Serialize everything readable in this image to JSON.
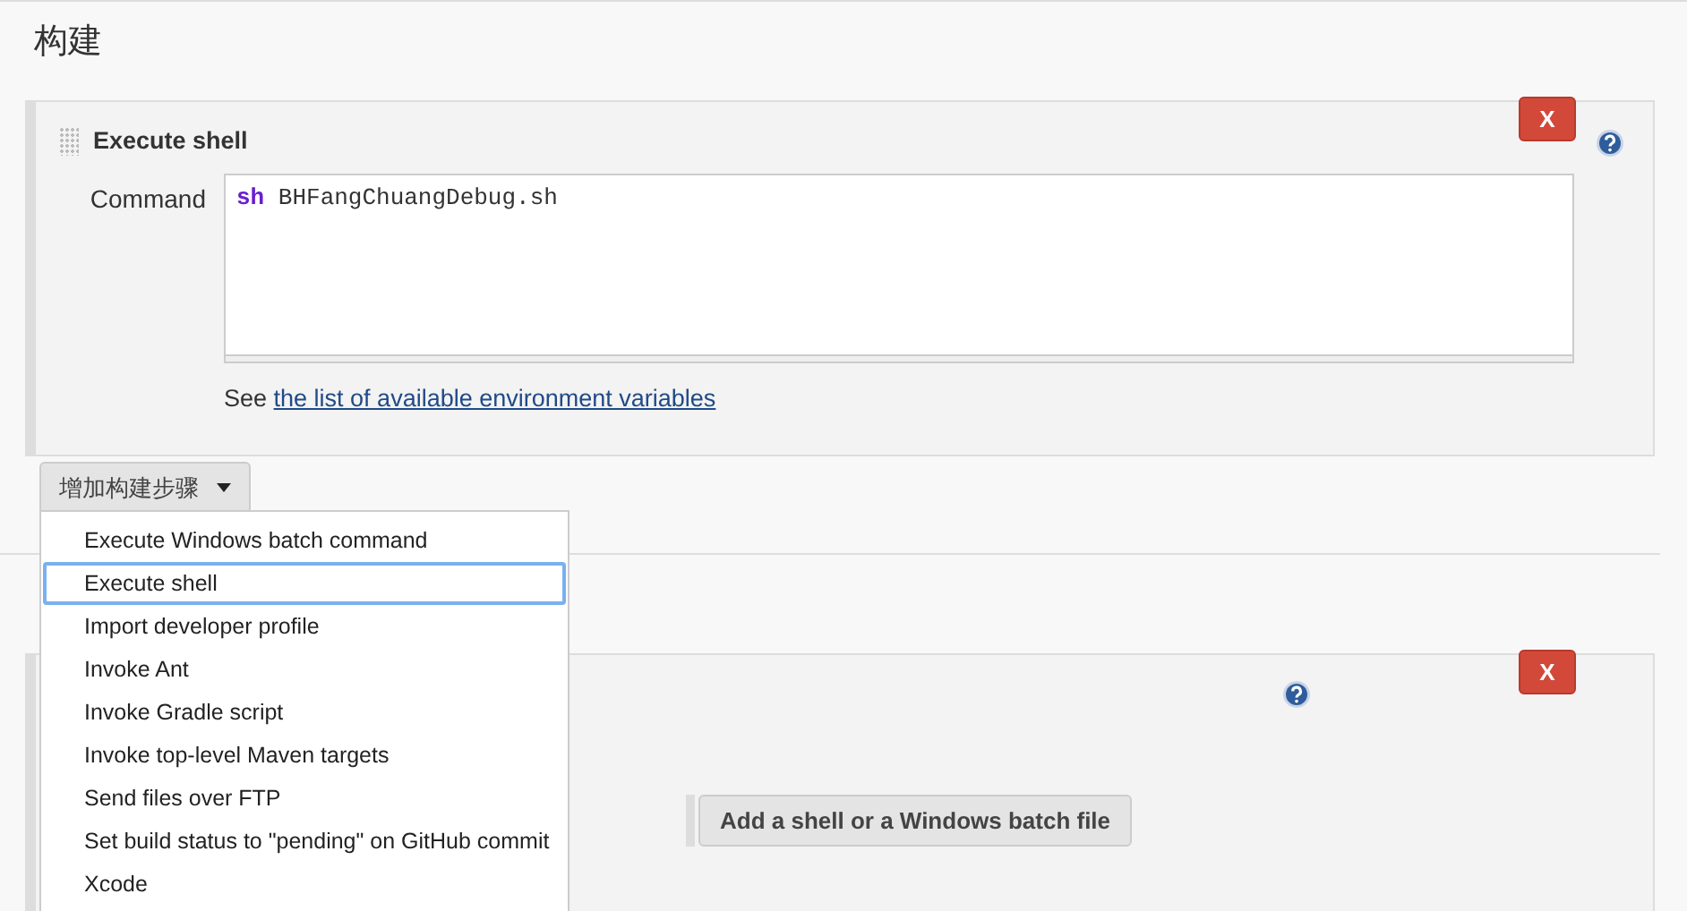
{
  "section": {
    "title": "构建"
  },
  "build_step": {
    "title": "Execute shell",
    "delete_label": "X",
    "command_label": "Command",
    "command": {
      "keyword": "sh",
      "args": "BHFangChuangDebug.sh"
    },
    "hint": "See",
    "hint_link": "the list of available environment variables"
  },
  "add_step_button": {
    "label": "增加构建步骤"
  },
  "dropdown": {
    "items": [
      {
        "label": "Execute Windows batch command",
        "selected": false
      },
      {
        "label": "Execute shell",
        "selected": true
      },
      {
        "label": "Import developer profile",
        "selected": false
      },
      {
        "label": "Invoke Ant",
        "selected": false
      },
      {
        "label": "Invoke Gradle script",
        "selected": false
      },
      {
        "label": "Invoke top-level Maven targets",
        "selected": false
      },
      {
        "label": "Send files over FTP",
        "selected": false
      },
      {
        "label": "Set build status to \"pending\" on GitHub commit",
        "selected": false
      },
      {
        "label": "Xcode",
        "selected": false
      }
    ]
  },
  "second_step": {
    "delete_label": "X",
    "button": "Add a shell or a Windows batch file"
  }
}
